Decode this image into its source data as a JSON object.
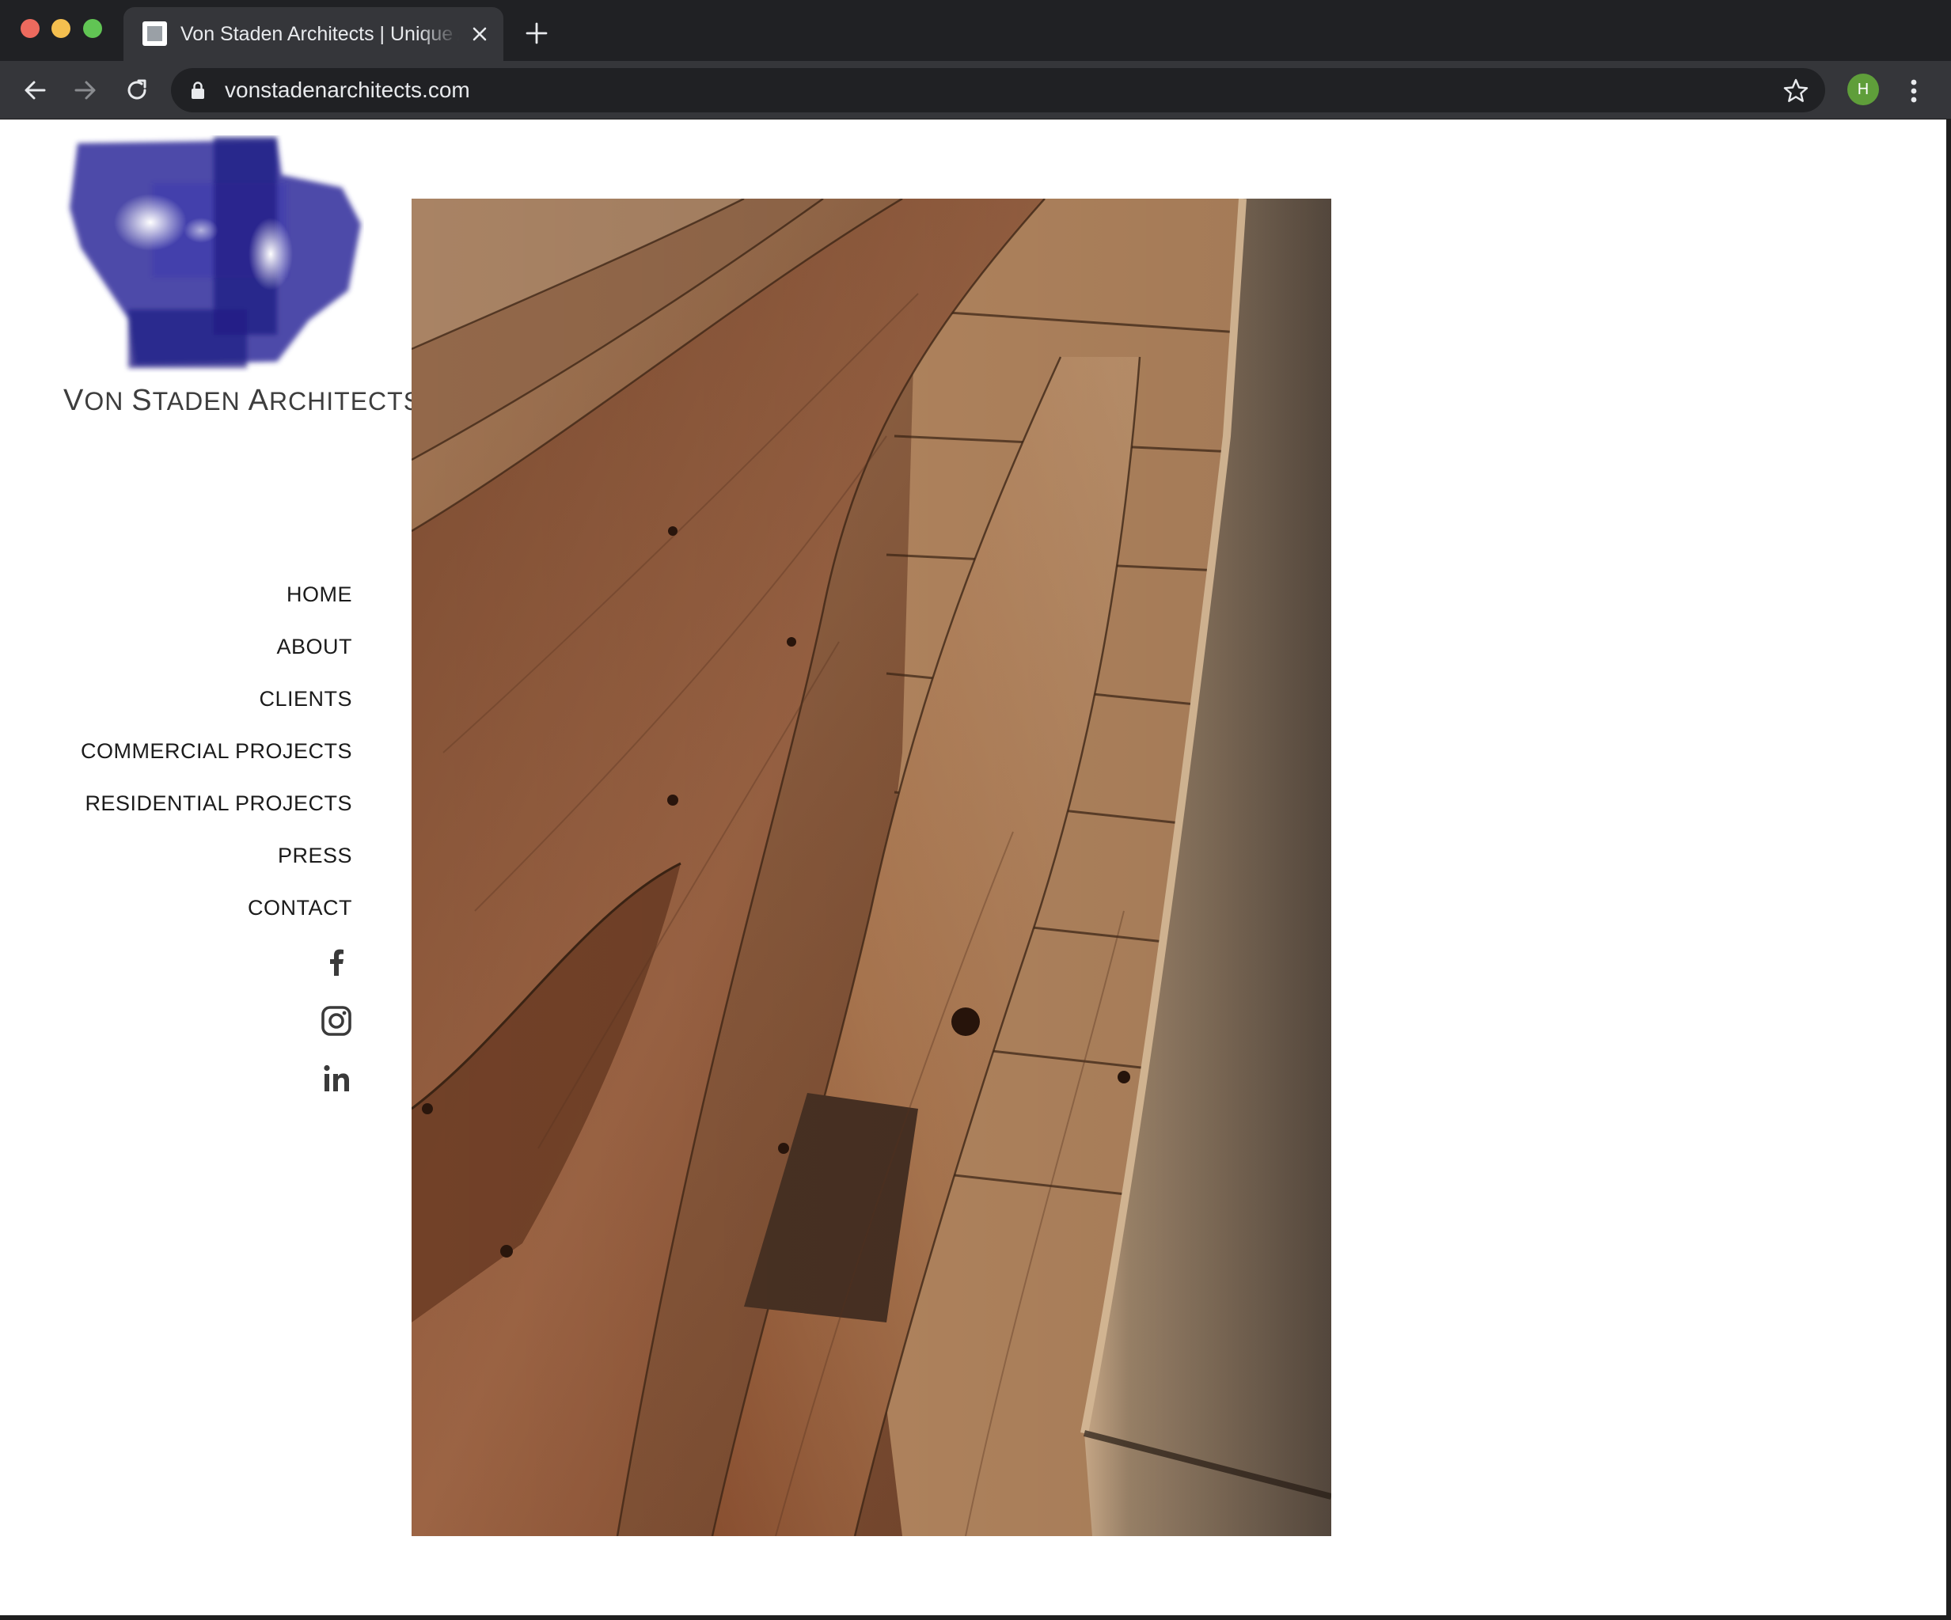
{
  "browser": {
    "tab": {
      "title": "Von Staden Architects | Unique Architecture",
      "close_icon": "close-icon",
      "favicon": "page-icon"
    },
    "new_tab_icon": "plus-icon",
    "toolbar": {
      "back_icon": "arrow-left-icon",
      "forward_icon": "arrow-right-icon",
      "reload_icon": "reload-icon",
      "url": "vonstadenarchitects.com",
      "lock_icon": "lock-icon",
      "bookmark_icon": "star-icon",
      "profile_initial": "H",
      "menu_icon": "kebab-menu-icon"
    }
  },
  "site": {
    "logo": {
      "text_parts": [
        "V",
        "ON ",
        "S",
        "TADEN ",
        "A",
        "RCHITECTS"
      ],
      "mark_color": "#2f2a9a"
    },
    "nav": [
      {
        "label": "HOME"
      },
      {
        "label": "ABOUT"
      },
      {
        "label": "CLIENTS"
      },
      {
        "label": "COMMERCIAL PROJECTS"
      },
      {
        "label": "RESIDENTIAL PROJECTS"
      },
      {
        "label": "PRESS"
      },
      {
        "label": "CONTACT"
      }
    ],
    "social": [
      {
        "icon": "facebook-icon"
      },
      {
        "icon": "instagram-icon"
      },
      {
        "icon": "linkedin-icon"
      }
    ],
    "hero": {
      "subject": "reclaimed wood plank floor"
    }
  },
  "colors": {
    "chrome_dark": "#202124",
    "chrome_toolbar": "#35363a",
    "nav_text": "#1b1b1b",
    "avatar": "#5f9e3a"
  }
}
